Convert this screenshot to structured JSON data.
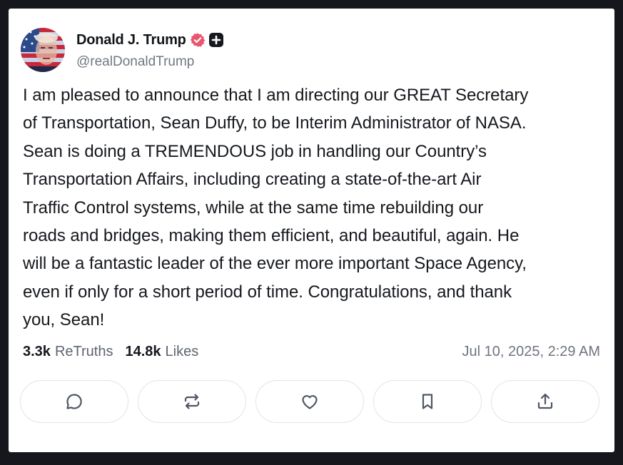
{
  "author": {
    "display_name": "Donald J. Trump",
    "handle": "@realDonaldTrump",
    "verified": true
  },
  "post": {
    "lines": [
      "I am pleased to announce that I am directing our GREAT Secretary",
      "of Transportation, Sean Duffy, to be Interim Administrator of NASA.",
      "Sean is doing a TREMENDOUS job in handling our Country’s",
      "Transportation Affairs, including creating a state-of-the-art Air",
      "Traffic Control systems, while at the same time rebuilding our",
      "roads and bridges, making them efficient, and beautiful, again. He",
      "will be a fantastic leader of the ever more important Space Agency,",
      "even if only for a short period of time. Congratulations, and thank",
      "you, Sean!"
    ]
  },
  "stats": {
    "retruths_count": "3.3k",
    "retruths_label": "ReTruths",
    "likes_count": "14.8k",
    "likes_label": "Likes"
  },
  "timestamp": "Jul 10, 2025, 2:29 AM",
  "actions": [
    {
      "name": "reply",
      "icon": "comment-icon"
    },
    {
      "name": "retruth",
      "icon": "repost-icon"
    },
    {
      "name": "like",
      "icon": "heart-icon"
    },
    {
      "name": "bookmark",
      "icon": "bookmark-icon"
    },
    {
      "name": "share",
      "icon": "share-icon"
    }
  ],
  "colors": {
    "background": "#16171d",
    "card": "#ffffff",
    "verified_badge": "#e8566f",
    "text": "#15181d",
    "muted": "#707784"
  }
}
